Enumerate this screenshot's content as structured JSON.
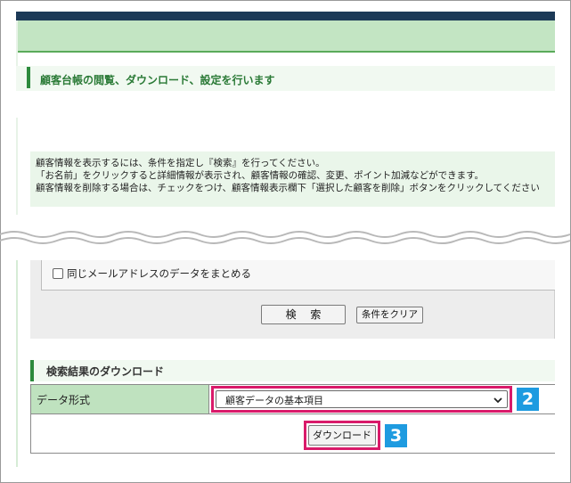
{
  "header": {
    "page_title": "顧客台帳の閲覧、ダウンロード、設定を行います"
  },
  "info": {
    "lines": [
      "顧客情報を表示するには、条件を指定し『検索』を行ってください。",
      "「お名前」をクリックすると詳細情報が表示され、顧客情報の確認、変更、ポイント加減などができます。",
      "顧客情報を削除する場合は、チェックをつけ、顧客情報表示欄下「選択した顧客を削除」ボタンをクリックしてください"
    ]
  },
  "search": {
    "merge_email_label": "同じメールアドレスのデータをまとめる",
    "search_button": "検 索",
    "clear_button": "条件をクリア"
  },
  "download": {
    "section_title": "検索結果のダウンロード",
    "format_label": "データ形式",
    "format_selected": "顧客データの基本項目",
    "download_button": "ダウンロード"
  },
  "annotations": {
    "step2": "2",
    "step3": "3"
  },
  "colors": {
    "header_dark": "#1c3a57",
    "header_green": "#c3e5c3",
    "accent_green": "#2c8a3c",
    "highlight": "#d91a6a",
    "badge_blue": "#1e9be0"
  }
}
